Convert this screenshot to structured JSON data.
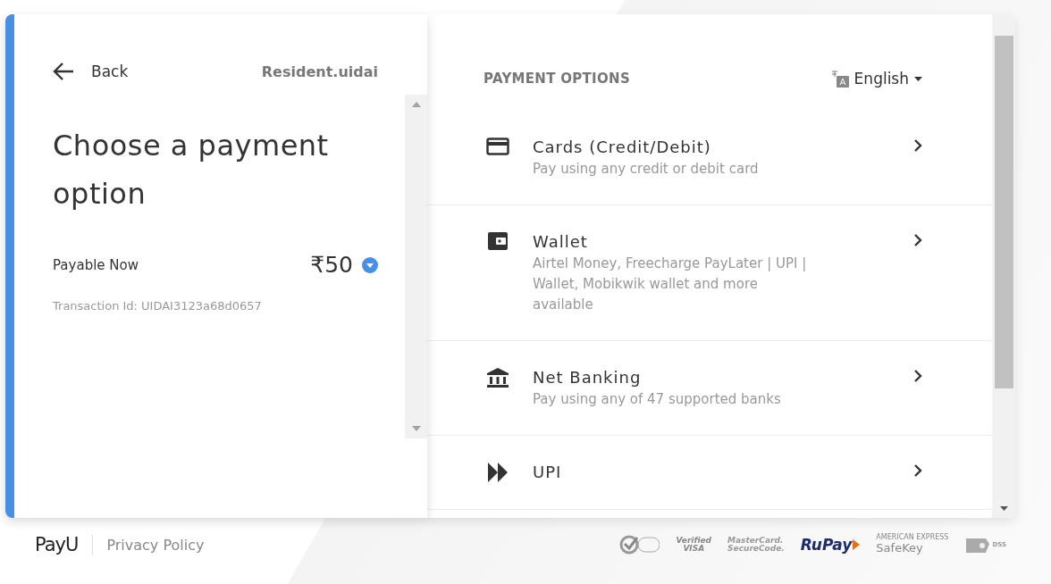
{
  "left": {
    "back": "Back",
    "merchant": "Resident.uidai",
    "title": "Choose a payment option",
    "payable_label": "Payable Now",
    "amount": "₹50",
    "transaction": "Transaction Id: UIDAI3123a68d0657"
  },
  "options_panel": {
    "heading": "PAYMENT OPTIONS",
    "language": "English"
  },
  "options": [
    {
      "kind": "card",
      "title": "Cards (Credit/Debit)",
      "subtitle": "Pay using any credit or debit card"
    },
    {
      "kind": "wallet",
      "title": "Wallet",
      "subtitle": "Airtel Money, Freecharge PayLater | UPI | Wallet, Mobikwik wallet and more available"
    },
    {
      "kind": "bank",
      "title": "Net Banking",
      "subtitle": "Pay using any of 47 supported banks"
    },
    {
      "kind": "upi",
      "title": "UPI"
    }
  ],
  "footer": {
    "brand": "PayU",
    "link": "Privacy Policy",
    "badges": [
      {
        "kind": "norton"
      },
      {
        "kind": "visa",
        "lines": [
          "Verified",
          "VISA"
        ]
      },
      {
        "kind": "mastercard",
        "lines": [
          "MasterCard.",
          "SecureCode."
        ]
      },
      {
        "kind": "rupay",
        "lines": [
          "RuPay"
        ]
      },
      {
        "kind": "safekey",
        "lines": [
          "AMERICAN EXPRESS",
          "SafeKey"
        ]
      },
      {
        "kind": "pci",
        "lines": [
          "DSS"
        ]
      }
    ]
  }
}
